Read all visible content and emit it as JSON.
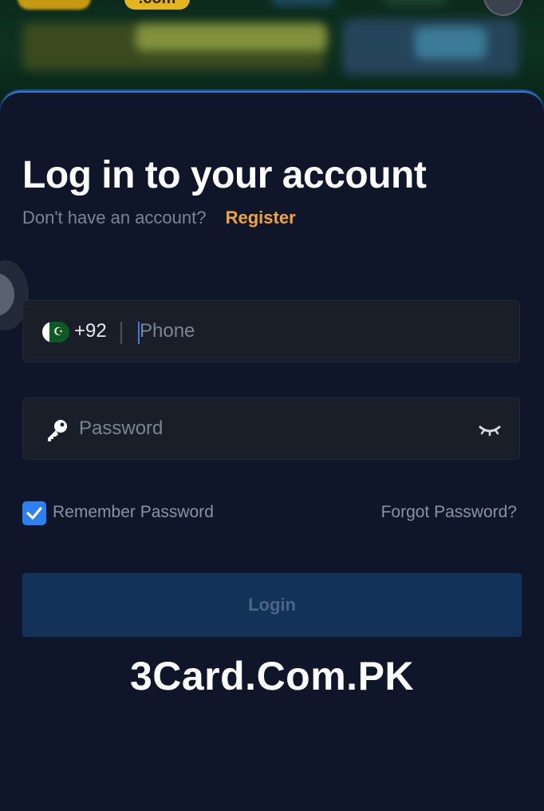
{
  "background": {
    "logo_text": ".com"
  },
  "login": {
    "title": "Log in to your account",
    "no_account_text": "Don't have an account?",
    "register_link": "Register",
    "phone": {
      "country_flag": "pakistan-flag-icon",
      "dial_code": "+92",
      "placeholder": "Phone",
      "value": ""
    },
    "password": {
      "icon": "key-icon",
      "placeholder": "Password",
      "value": "",
      "toggle_icon": "eye-closed-icon"
    },
    "remember": {
      "label": "Remember Password",
      "checked": true
    },
    "forgot_link": "Forgot Password?",
    "login_button": "Login"
  },
  "watermark": "3Card.Com.PK",
  "colors": {
    "background": "#0f1629",
    "accent_orange": "#f0a43c",
    "checkbox_blue": "#2e7ff0",
    "panel_border": "#2a7fd4",
    "button_disabled": "#123258"
  }
}
